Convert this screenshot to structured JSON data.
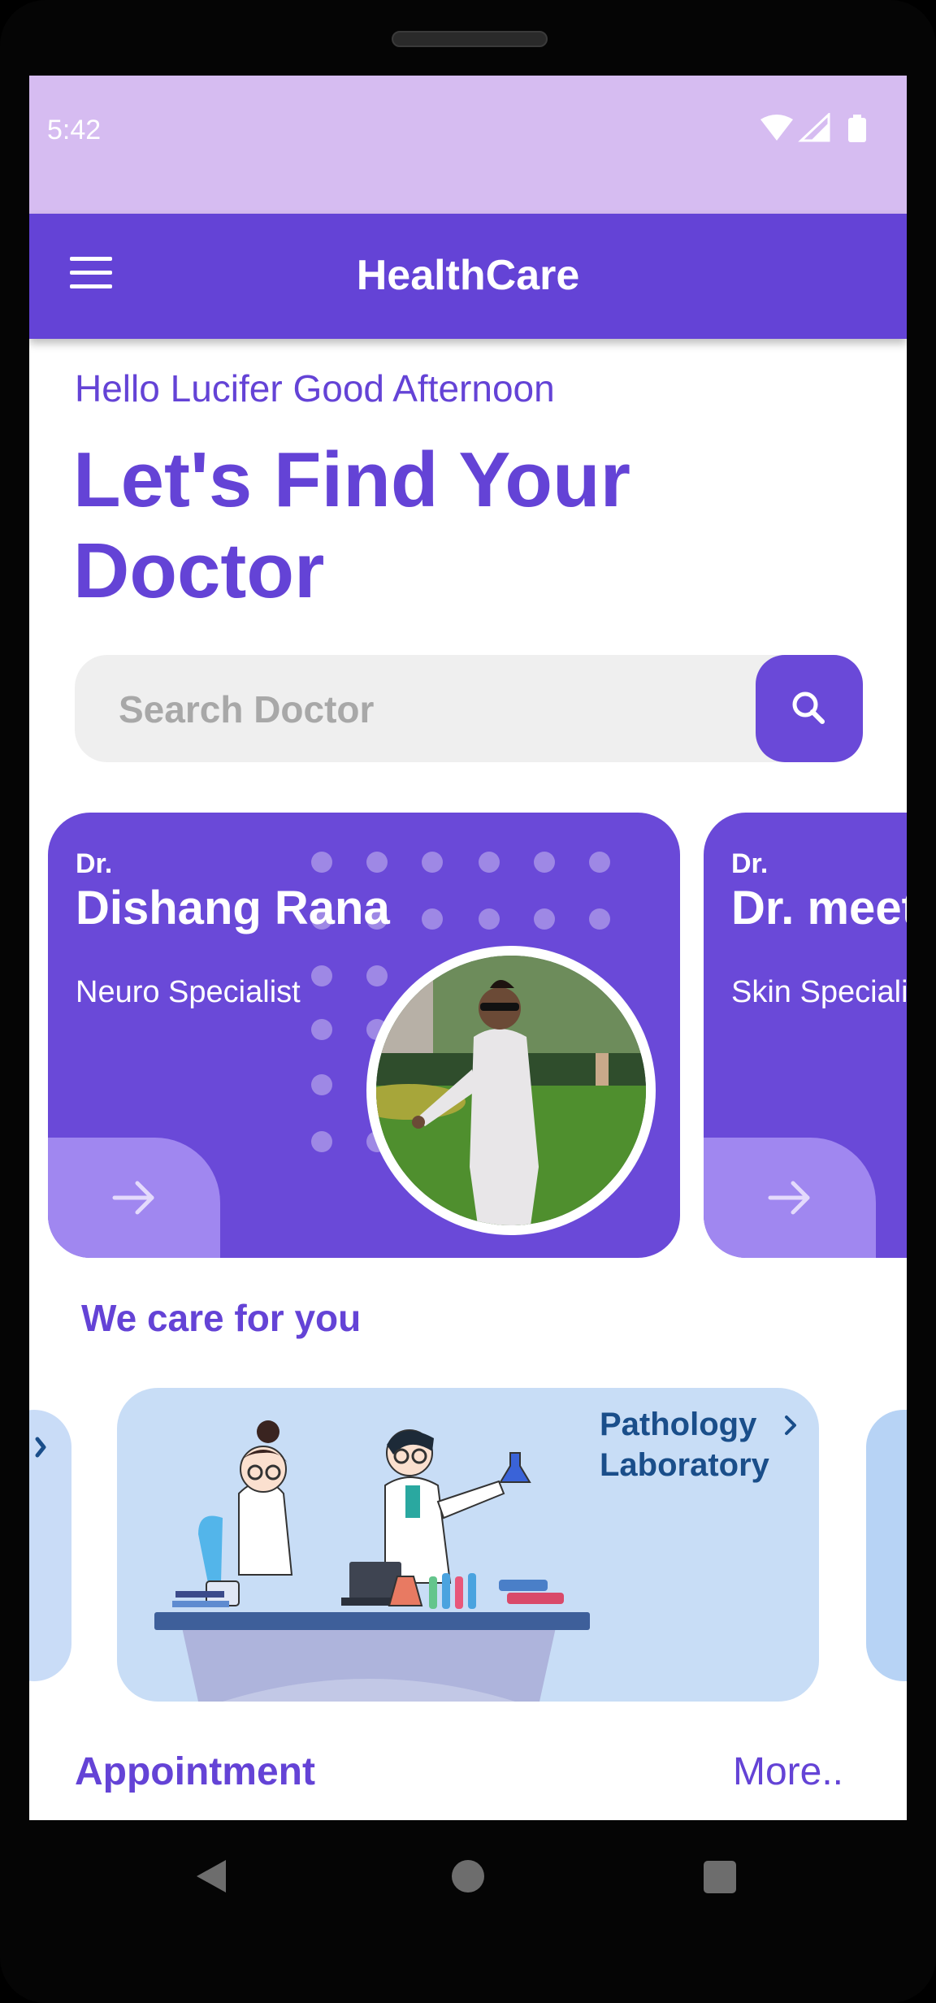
{
  "status_bar": {
    "time": "5:42"
  },
  "app_bar": {
    "title": "HealthCare"
  },
  "greeting": "Hello Lucifer Good Afternoon",
  "headline": "Let's Find Your Doctor",
  "search": {
    "placeholder": "Search Doctor"
  },
  "doctors": [
    {
      "prefix": "Dr.",
      "name": "Dishang Rana",
      "specialty": "Neuro Specialist"
    },
    {
      "prefix": "Dr.",
      "name": "Dr. meet",
      "specialty": "Skin Specialist"
    }
  ],
  "care_section": {
    "title": "We care for you",
    "card_label": "Pathology Laboratory"
  },
  "appointment": {
    "title": "Appointment",
    "more_label": "More.."
  },
  "colors": {
    "primary": "#6443d6",
    "status_bar": "#d6bcf1",
    "card_accent": "#a087f0",
    "care_card": "#c8ddf6"
  },
  "icons": [
    "menu-icon",
    "search-icon",
    "arrow-right-icon",
    "chevron-right-icon",
    "wifi-icon",
    "signal-icon",
    "battery-icon",
    "nav-back-icon",
    "nav-home-icon",
    "nav-recents-icon"
  ]
}
